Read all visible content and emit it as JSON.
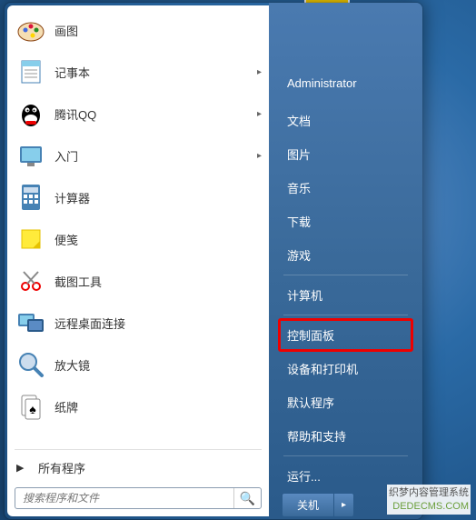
{
  "user": {
    "name": "Administrator"
  },
  "programs": [
    {
      "label": "画图",
      "icon": "paint",
      "expandable": false
    },
    {
      "label": "记事本",
      "icon": "notepad",
      "expandable": true
    },
    {
      "label": "腾讯QQ",
      "icon": "qq",
      "expandable": true
    },
    {
      "label": "入门",
      "icon": "getting-started",
      "expandable": true
    },
    {
      "label": "计算器",
      "icon": "calculator",
      "expandable": false
    },
    {
      "label": "便笺",
      "icon": "sticky-notes",
      "expandable": false
    },
    {
      "label": "截图工具",
      "icon": "snipping",
      "expandable": false
    },
    {
      "label": "远程桌面连接",
      "icon": "rdp",
      "expandable": false
    },
    {
      "label": "放大镜",
      "icon": "magnifier",
      "expandable": false
    },
    {
      "label": "纸牌",
      "icon": "solitaire",
      "expandable": false
    }
  ],
  "all_programs_label": "所有程序",
  "search": {
    "placeholder": "搜索程序和文件"
  },
  "right_items": [
    {
      "label": "文档",
      "name": "documents"
    },
    {
      "label": "图片",
      "name": "pictures"
    },
    {
      "label": "音乐",
      "name": "music"
    },
    {
      "label": "下载",
      "name": "downloads"
    },
    {
      "label": "游戏",
      "name": "games",
      "sep_after": true
    },
    {
      "label": "计算机",
      "name": "computer",
      "sep_after": true
    },
    {
      "label": "控制面板",
      "name": "control-panel",
      "highlighted": true
    },
    {
      "label": "设备和打印机",
      "name": "devices-printers"
    },
    {
      "label": "默认程序",
      "name": "default-programs"
    },
    {
      "label": "帮助和支持",
      "name": "help-support",
      "sep_after": true
    },
    {
      "label": "运行...",
      "name": "run"
    }
  ],
  "shutdown": {
    "label": "关机"
  },
  "badge": {
    "line1": "织梦内容管理系统",
    "line2": "DEDECMS.COM"
  }
}
